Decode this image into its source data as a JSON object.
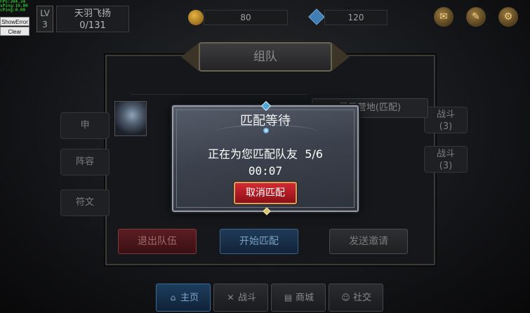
{
  "debug": {
    "fps_lines": [
      "FPS:204.24",
      "sPing:10.00",
      "cPing:0.00"
    ],
    "show_error_label": "ShowError",
    "clear_label": "Clear"
  },
  "hud": {
    "level_prefix": "LV",
    "level_value": "3",
    "player_name": "天羽飞扬",
    "exp": "0/131",
    "coins": "80",
    "gems": "120",
    "icons": [
      "chat-bubble-icon",
      "mail-icon",
      "settings-gear-icon"
    ]
  },
  "team_panel": {
    "title": "组队",
    "left_tabs": [
      "申",
      "阵容",
      "符文"
    ],
    "map_label": "暴风营地(匹配)",
    "right_tabs": [
      {
        "line1": "战斗",
        "line2": "(3)"
      },
      {
        "line1": "战斗",
        "line2": "(3)"
      }
    ],
    "exit_label": "退出队伍",
    "start_label": "开始匹配",
    "invite_label": "发送邀请"
  },
  "bottom_nav": [
    {
      "label": "主页",
      "icon": "home-icon"
    },
    {
      "label": "战斗",
      "icon": "swords-icon"
    },
    {
      "label": "商城",
      "icon": "shop-icon"
    },
    {
      "label": "社交",
      "icon": "social-icon"
    }
  ],
  "modal": {
    "title": "匹配等待",
    "message": "正在为您匹配队友  5/6",
    "timer": "00:07",
    "cancel_label": "取消匹配"
  }
}
